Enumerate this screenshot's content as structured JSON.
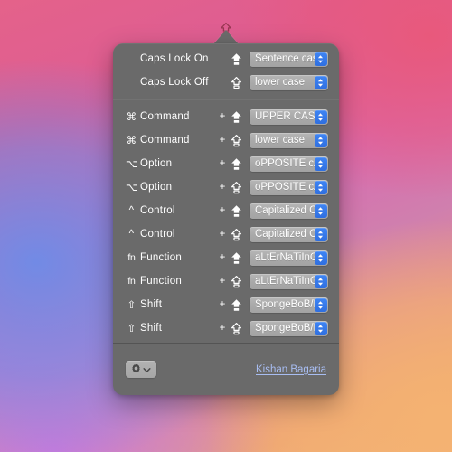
{
  "desktop": {
    "menubar_icon": "caps-lock-arrow-icon",
    "wallpaper_colors": [
      "#e4628a",
      "#6c8ce8",
      "#c478e2",
      "#f2b377",
      "#e9587a"
    ]
  },
  "popover": {
    "panel_color": "#6a6a6a",
    "accent_color": "#3f85f4",
    "link_color": "#a8bdf2",
    "groups": [
      {
        "name": "caps-lock-group",
        "rows": [
          {
            "modifier_symbol": "",
            "modifier_name": "Caps Lock On",
            "plus": "",
            "arrow_icon": "caps-lock-filled-icon",
            "value": "Sentence case"
          },
          {
            "modifier_symbol": "",
            "modifier_name": "Caps Lock Off",
            "plus": "",
            "arrow_icon": "caps-lock-hollow-icon",
            "value": "lower case"
          }
        ]
      },
      {
        "name": "modifier-combos-group",
        "rows": [
          {
            "modifier_symbol": "⌘",
            "modifier_name": "Command",
            "plus": "+",
            "arrow_icon": "caps-lock-filled-icon",
            "value": "UPPER CASE"
          },
          {
            "modifier_symbol": "⌘",
            "modifier_name": "Command",
            "plus": "+",
            "arrow_icon": "caps-lock-hollow-icon",
            "value": "lower case"
          },
          {
            "modifier_symbol": "⌥",
            "modifier_name": "Option",
            "plus": "+",
            "arrow_icon": "caps-lock-filled-icon",
            "value": "oPPOSITE cASE"
          },
          {
            "modifier_symbol": "⌥",
            "modifier_name": "Option",
            "plus": "+",
            "arrow_icon": "caps-lock-hollow-icon",
            "value": "oPPOSITE cASE"
          },
          {
            "modifier_symbol": "^",
            "modifier_name": "Control",
            "plus": "+",
            "arrow_icon": "caps-lock-filled-icon",
            "value": "Capitalized Case"
          },
          {
            "modifier_symbol": "^",
            "modifier_name": "Control",
            "plus": "+",
            "arrow_icon": "caps-lock-hollow-icon",
            "value": "Capitalized Case"
          },
          {
            "modifier_symbol": "fn",
            "modifier_name": "Function",
            "plus": "+",
            "arrow_icon": "caps-lock-filled-icon",
            "value": "aLtErNaTiInG C..."
          },
          {
            "modifier_symbol": "fn",
            "modifier_name": "Function",
            "plus": "+",
            "arrow_icon": "caps-lock-hollow-icon",
            "value": "aLtErNaTiInG C..."
          },
          {
            "modifier_symbol": "⇧",
            "modifier_name": "Shift",
            "plus": "+",
            "arrow_icon": "caps-lock-filled-icon",
            "value": "SpongeBoB/Ra..."
          },
          {
            "modifier_symbol": "⇧",
            "modifier_name": "Shift",
            "plus": "+",
            "arrow_icon": "caps-lock-hollow-icon",
            "value": "SpongeBoB/Ra..."
          }
        ]
      }
    ],
    "footer": {
      "settings_button_icon": "gear-icon",
      "settings_button_chevron": "chevron-down-icon",
      "author_link": "Kishan Bagaria"
    }
  }
}
